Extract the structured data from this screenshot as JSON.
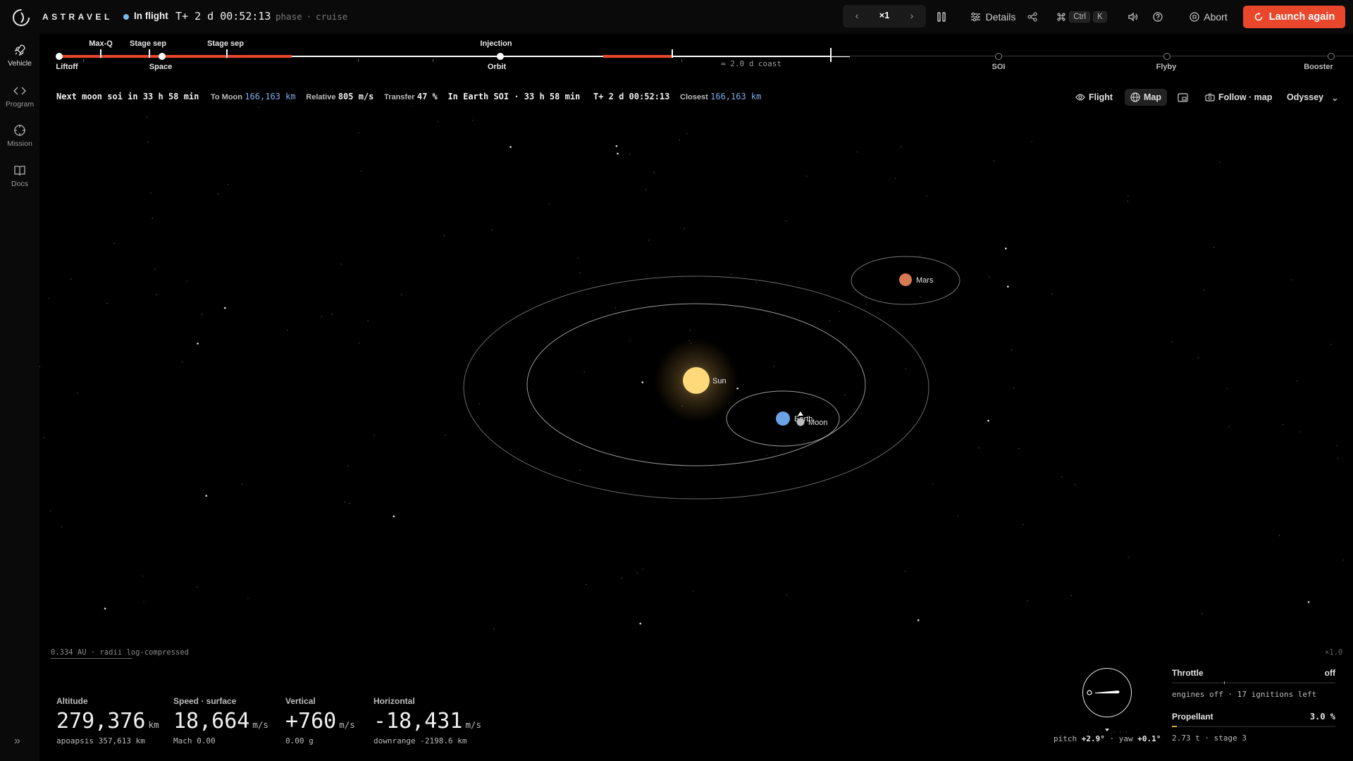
{
  "app": {
    "brand": "ASTRAVEL"
  },
  "topbar": {
    "status": "In flight",
    "clock": "T+ 2 d 00:52:13",
    "phase_label": "phase",
    "phase_value": "cruise",
    "speed": "×1",
    "details_label": "Details",
    "kbd_ctrl": "Ctrl",
    "kbd_k": "K",
    "abort_label": "Abort",
    "launch_label": "Launch again"
  },
  "sidebar": {
    "items": [
      {
        "label": "Vehicle",
        "icon": "rocket-icon"
      },
      {
        "label": "Program",
        "icon": "code-icon"
      },
      {
        "label": "Mission",
        "icon": "crosshair-icon"
      },
      {
        "label": "Docs",
        "icon": "book-icon"
      }
    ]
  },
  "timeline": {
    "top_labels": [
      "Max-Q",
      "Stage sep",
      "Stage sep",
      "Injection"
    ],
    "bottom_labels": [
      "Liftoff",
      "Space",
      "Orbit"
    ],
    "future_labels": [
      "SOI",
      "Flyby",
      "Booster"
    ],
    "coast": "≈ 2.0 d coast",
    "progress_fraction": 0.48
  },
  "inforow": {
    "next_event": "Next moon soi in 33 h 58 min",
    "to_moon_label": "To Moon",
    "to_moon_value": "166,163 km",
    "relative_label": "Relative",
    "relative_value": "805 m/s",
    "transfer_label": "Transfer",
    "transfer_value": "47 %",
    "soi_text": "In Earth SOI · 33 h 58 min",
    "clock": "T+ 2 d 00:52:13",
    "closest_label": "Closest",
    "closest_value": "166,163 km"
  },
  "view": {
    "flight": "Flight",
    "map": "Map",
    "follow": "Follow · map",
    "vehicle": "Odyssey"
  },
  "map": {
    "bodies": [
      "Sun",
      "Earth",
      "Moon",
      "Mars"
    ],
    "scale": "0.334 AU  ·  radii log-compressed",
    "zoom": "×1.0"
  },
  "telemetry": {
    "altitude": {
      "label": "Altitude",
      "value": "279,376",
      "unit": "km",
      "sub": "apoapsis 357,613 km"
    },
    "speed": {
      "label": "Speed · surface",
      "value": "18,664",
      "unit": "m/s",
      "sub": "Mach 0.00"
    },
    "vertical": {
      "label": "Vertical",
      "value": "+760",
      "unit": "m/s",
      "sub": "0.00 g"
    },
    "horizontal": {
      "label": "Horizontal",
      "value": "-18,431",
      "unit": "m/s",
      "sub": "downrange -2198.6 km"
    }
  },
  "attitude": {
    "pitch_label": "pitch",
    "pitch": "+2.9°",
    "yaw_label": "yaw",
    "yaw": "+0.1°"
  },
  "throttle": {
    "label": "Throttle",
    "value": "off",
    "sub": "engines off · 17 ignitions left",
    "fraction": 0
  },
  "propellant": {
    "label": "Propellant",
    "value": "3.0 %",
    "sub": "2.73 t · stage 3",
    "fraction": 0.03
  },
  "colors": {
    "accent": "#e8472b",
    "blue": "#7fb0ea",
    "sun": "#ffd97a",
    "earth": "#6aa2e6",
    "mars": "#d77a52"
  }
}
